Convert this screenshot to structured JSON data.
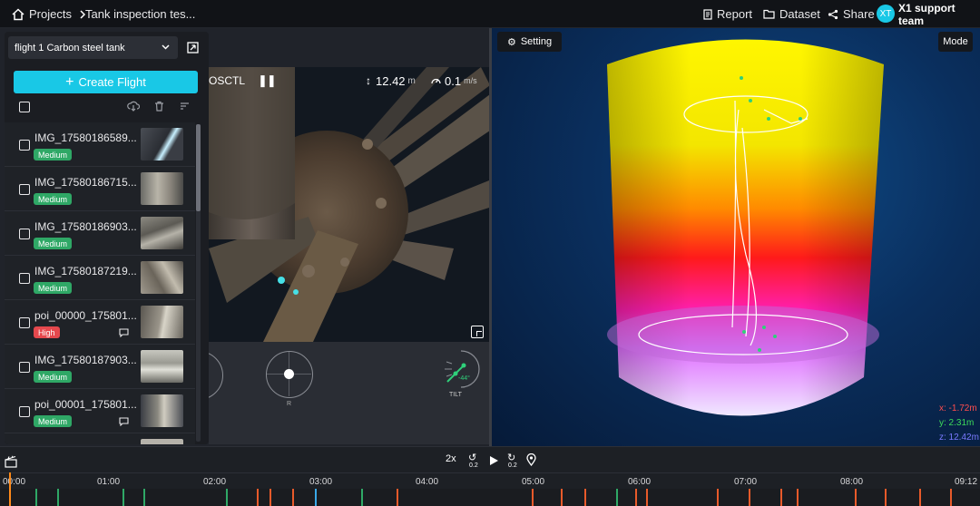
{
  "header": {
    "home_label": "Projects",
    "breadcrumb_current": "Tank inspection tes...",
    "report_label": "Report",
    "dataset_label": "Dataset",
    "share_label": "Share",
    "avatar_initials": "XT",
    "team_label": "X1 support team"
  },
  "sidebar": {
    "flight_select_value": "flight 1 Carbon steel tank",
    "create_flight_label": "Create Flight",
    "items": [
      {
        "name": "IMG_17580186589...",
        "severity": "Medium",
        "has_comment": false
      },
      {
        "name": "IMG_17580186715...",
        "severity": "Medium",
        "has_comment": false
      },
      {
        "name": "IMG_17580186903...",
        "severity": "Medium",
        "has_comment": false
      },
      {
        "name": "IMG_17580187219...",
        "severity": "Medium",
        "has_comment": false
      },
      {
        "name": "poi_00000_175801...",
        "severity": "High",
        "has_comment": true
      },
      {
        "name": "IMG_17580187903...",
        "severity": "Medium",
        "has_comment": false
      },
      {
        "name": "poi_00001_175801...",
        "severity": "Medium",
        "has_comment": true
      }
    ]
  },
  "camera": {
    "mode_label": "OSCTL",
    "altitude_value": "12.42",
    "altitude_unit": "m",
    "speed_value": "0.1",
    "speed_unit": "m/s",
    "joystick_label": "R",
    "tilt_label": "TILT",
    "tilt_value": "-44°"
  },
  "pointcloud": {
    "setting_label": "Setting",
    "mode_label": "Mode",
    "x_coord": "x: -1.72m",
    "y_coord": "y: 2.31m",
    "z_coord": "z: 12.42m"
  },
  "playback": {
    "speed_label": "2x",
    "rewind_step": "0.2",
    "forward_step": "0.2",
    "ticks": [
      "00:00",
      "01:00",
      "02:00",
      "03:00",
      "04:00",
      "05:00",
      "06:00",
      "07:00",
      "08:00",
      "09:12"
    ]
  },
  "colors": {
    "accent": "#19c8e6",
    "medium": "#2fa866",
    "high": "#e5484d"
  }
}
